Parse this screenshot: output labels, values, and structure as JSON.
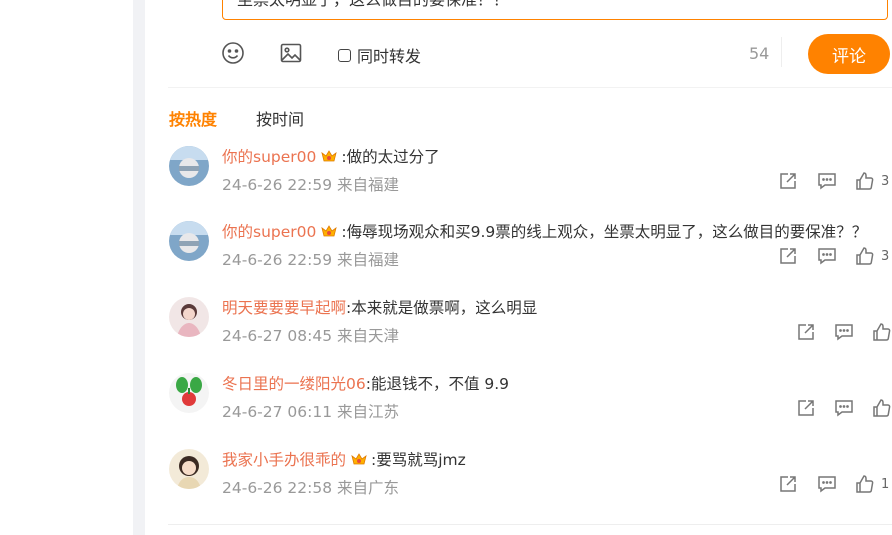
{
  "composer": {
    "text": "坐票太明显了，这么做目的要保准？？",
    "repost_label": "同时转发",
    "char_count": "54",
    "submit_label": "评论"
  },
  "sort": {
    "hot_label": "按热度",
    "time_label": "按时间"
  },
  "comments": [
    {
      "user": "你的super00",
      "text": ":做的太过分了",
      "meta": "24-6-26 22:59 来自福建",
      "likes": "3",
      "vip": true
    },
    {
      "user": "你的super00",
      "text": ":侮辱现场观众和买9.9票的线上观众，坐票太明显了，这么做目的要保准？？",
      "meta": "24-6-26 22:59 来自福建",
      "likes": "3",
      "vip": true
    },
    {
      "user": "明天要要要早起啊",
      "text": ":本来就是做票啊，这么明显",
      "meta": "24-6-27 08:45 来自天津",
      "likes": "",
      "vip": false
    },
    {
      "user": "冬日里的一缕阳光06",
      "text": ":能退钱不，不值 9.9",
      "meta": "24-6-27 06:11 来自江苏",
      "likes": "",
      "vip": false
    },
    {
      "user": "我家小手办很乖的",
      "text": ":要骂就骂jmz",
      "meta": "24-6-26 22:58 来自广东",
      "likes": "1",
      "vip": true
    }
  ],
  "colors": {
    "accent": "#ff8200",
    "username": "#eb7350"
  }
}
